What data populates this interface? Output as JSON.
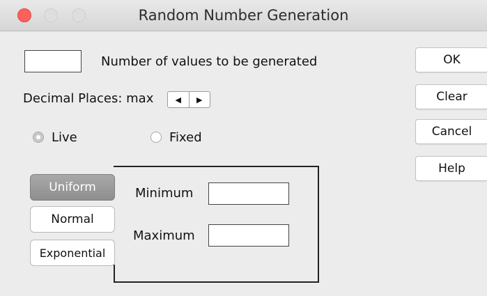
{
  "window": {
    "title": "Random Number Generation"
  },
  "form": {
    "count_label": "Number of values to be generated",
    "count_value": "",
    "decimal_label": "Decimal Places: max",
    "radio_live": "Live",
    "radio_fixed": "Fixed",
    "selected_mode": "Live"
  },
  "buttons": {
    "ok": "OK",
    "clear": "Clear",
    "cancel": "Cancel",
    "help": "Help"
  },
  "distributions": {
    "items": [
      "Uniform",
      "Normal",
      "Exponential"
    ],
    "selected": "Uniform"
  },
  "params": {
    "minimum_label": "Minimum",
    "minimum_value": "",
    "maximum_label": "Maximum",
    "maximum_value": ""
  },
  "icons": {
    "stepper_left": "triangle-left-icon",
    "stepper_right": "triangle-right-icon"
  }
}
